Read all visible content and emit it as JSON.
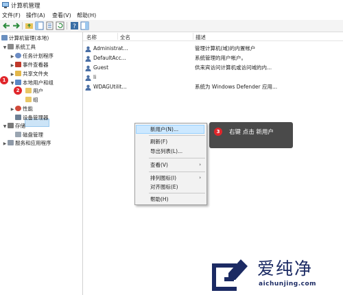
{
  "window": {
    "title": "计算机管理"
  },
  "menu": [
    "文件(F)",
    "操作(A)",
    "查看(V)",
    "帮助(H)"
  ],
  "tree": {
    "root": "计算机管理(本地)",
    "system_tools": "系统工具",
    "task_scheduler": "任务计划程序",
    "event_viewer": "事件查看器",
    "shared_folders": "共享文件夹",
    "local_users_groups": "本地用户和组",
    "users": "用户",
    "groups": "组",
    "performance": "性能",
    "device_manager": "设备管理器",
    "storage": "存储",
    "disk_management": "磁盘管理",
    "services_apps": "服务和应用程序"
  },
  "list": {
    "columns": [
      "名称",
      "全名",
      "描述"
    ],
    "rows": [
      {
        "name": "Administrat...",
        "full": "",
        "desc": "管理计算机(域)的内置帐户"
      },
      {
        "name": "DefaultAcc...",
        "full": "",
        "desc": "系统管理的用户帐户。"
      },
      {
        "name": "Guest",
        "full": "",
        "desc": "供来宾访问计算机或访问域的内..."
      },
      {
        "name": "li",
        "full": "",
        "desc": ""
      },
      {
        "name": "WDAGUtilit...",
        "full": "",
        "desc": "系统为 Windows Defender 应用..."
      }
    ]
  },
  "context_menu": {
    "new_user": "新用户(N)...",
    "refresh": "刷新(F)",
    "export": "导出列表(L)...",
    "view": "查看(V)",
    "arrange": "排列图标(I)",
    "align": "对齐图标(E)",
    "help": "帮助(H)"
  },
  "steps": {
    "s1": "1",
    "s2": "2",
    "s3": "3"
  },
  "callout": {
    "text": "右键 点击 新用户"
  },
  "watermark": {
    "chinese": "爱纯净",
    "url": "aichunjing.com"
  },
  "colors": {
    "badge": "#e0262b",
    "callout_bg": "#4a4a4a",
    "selection": "#cce4f7",
    "brand": "#1b2a63"
  }
}
